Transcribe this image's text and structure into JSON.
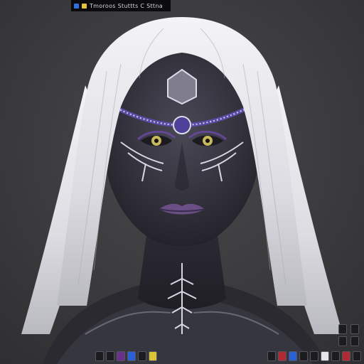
{
  "window": {
    "title_text": "Tmoroos Stuttts C Sttna"
  },
  "colors": {
    "background": "#3c3b3e",
    "skin": "#3a3944",
    "hair": "#e9e9ee",
    "tattoo": "#cfcfe0",
    "gem_purple": "#5b4aa6",
    "eye": "#c9b85a",
    "lips": "#6a4f86"
  },
  "taskbar": {
    "left_icons": [
      "app-icon-dark",
      "app-icon-dark",
      "app-icon-purple",
      "app-icon-blue",
      "app-icon-dark",
      "app-icon-yellow"
    ],
    "right_icons": [
      "tray-icon-1",
      "tray-icon-2",
      "tray-icon-3",
      "tray-icon-4",
      "tray-icon-5",
      "tray-icon-6",
      "tray-icon-7",
      "tray-icon-8",
      "tray-icon-9"
    ]
  }
}
